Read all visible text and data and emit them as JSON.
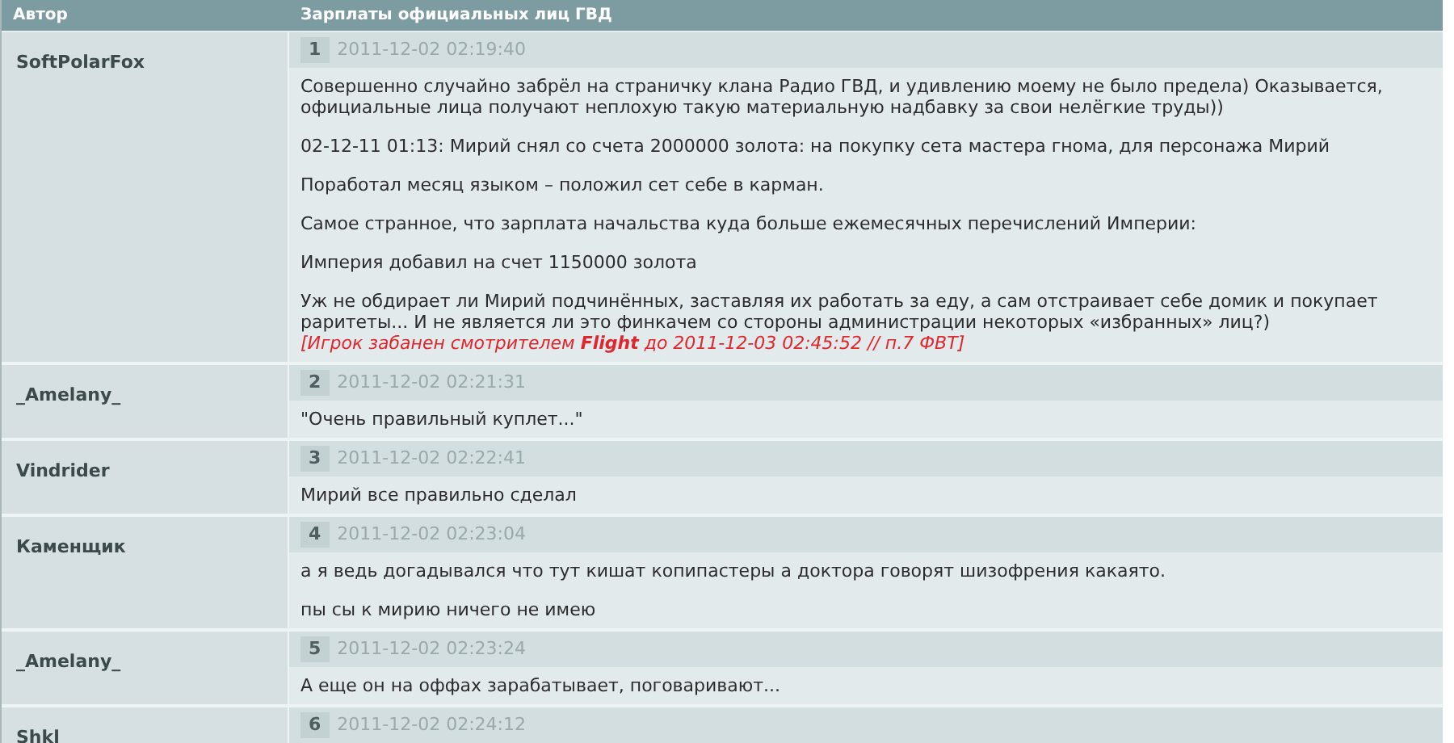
{
  "table": {
    "columns": [
      "Автор",
      "Зарплаты официальных лиц ГВД"
    ],
    "posts": [
      {
        "author": "SoftPolarFox",
        "number": "1",
        "date": "2011-12-02 02:19:40",
        "paragraphs": [
          {
            "kind": "text",
            "text": "Совершенно случайно забрёл на страничку клана Радио ГВД, и удивлению моему не было предела) Оказывается, официальные лица получают неплохую такую материальную надбавку за свои нелёгкие труды))"
          },
          {
            "kind": "text",
            "text": "02-12-11 01:13: Мирий снял со счета 2000000 золота: на покупку сета мастера гнома, для персонажа Мирий"
          },
          {
            "kind": "text",
            "text": "Поработал месяц языком – положил сет себе в карман."
          },
          {
            "kind": "text",
            "text": "Самое странное, что зарплата начальства куда больше ежемесячных перечислений Империи:"
          },
          {
            "kind": "text",
            "text": "Империя добавил на счет 1150000 золота"
          },
          {
            "kind": "text",
            "text": "Уж не обдирает ли Мирий подчинённых, заставляя их работать за еду, а сам отстраивает себе домик и покупает раритеты... И не является ли это финкачем со стороны администрации некоторых «избранных» лиц?)"
          },
          {
            "kind": "ban",
            "text": "[Игрок забанен смотрителем **Flight** до 2011-12-03 02:45:52 // п.7 ФВТ]"
          }
        ]
      },
      {
        "author": "_Amelany_",
        "number": "2",
        "date": "2011-12-02 02:21:31",
        "paragraphs": [
          {
            "kind": "text",
            "text": "\"Очень правильный куплет...\""
          }
        ]
      },
      {
        "author": "Vindrider",
        "number": "3",
        "date": "2011-12-02 02:22:41",
        "paragraphs": [
          {
            "kind": "text",
            "text": "Мирий все правильно сделал"
          }
        ]
      },
      {
        "author": "Каменщик",
        "number": "4",
        "date": "2011-12-02 02:23:04",
        "paragraphs": [
          {
            "kind": "text",
            "text": "а я ведь догадывался что тут кишат копипастеры а доктора говорят шизофрения какаято."
          },
          {
            "kind": "text",
            "text": "пы сы к мирию ничего не имею"
          }
        ]
      },
      {
        "author": "_Amelany_",
        "number": "5",
        "date": "2011-12-02 02:23:24",
        "paragraphs": [
          {
            "kind": "text",
            "text": "А еще он на оффах зарабатывает, поговаривают..."
          }
        ]
      },
      {
        "author": "Shkl",
        "number": "6",
        "date": "2011-12-02 02:24:12"
      }
    ]
  }
}
